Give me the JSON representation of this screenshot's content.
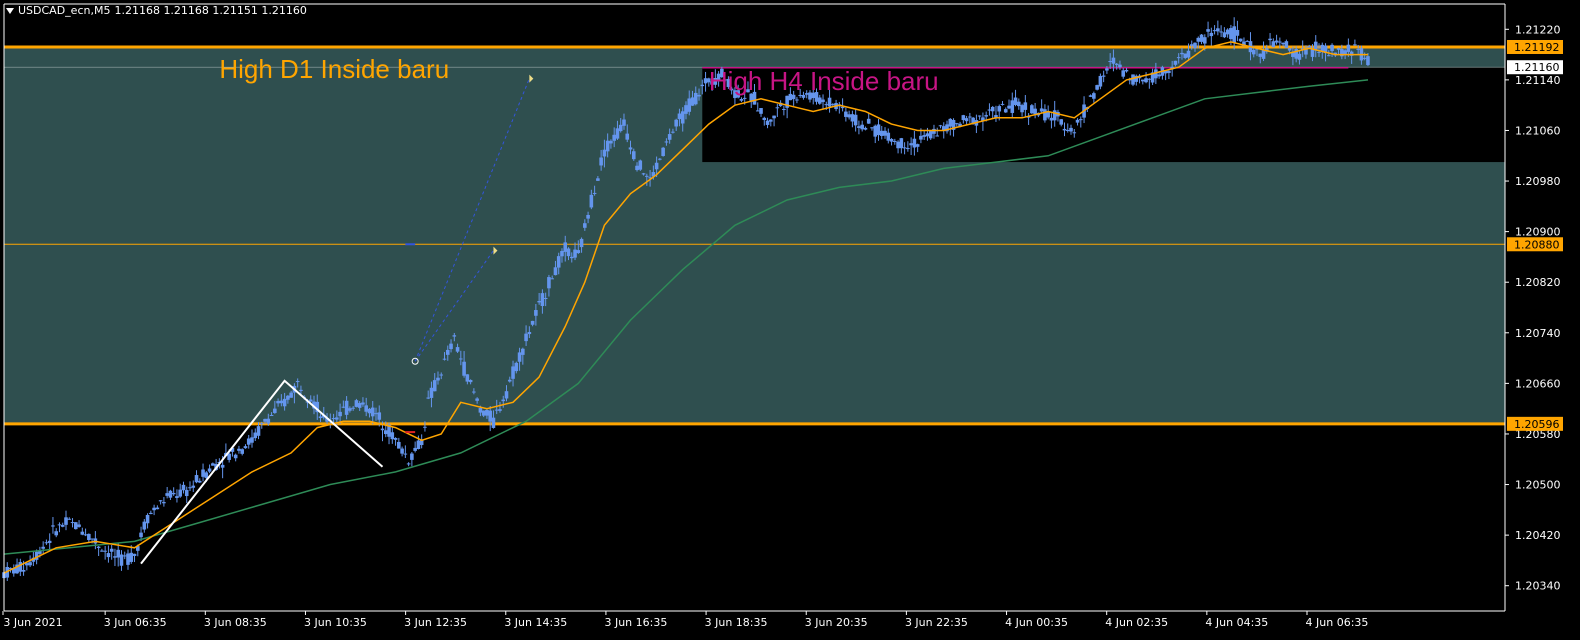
{
  "header": {
    "symbol": "USDCAD_ecn,M5",
    "ohlc": "1.21168 1.21168 1.21151 1.21160"
  },
  "colors": {
    "background": "#000000",
    "candle": "#6495ED",
    "fast_ma": "#FFA500",
    "slow_ma": "#2E8B57",
    "zone_fill": "#2F4F4F",
    "h4_zone": "#000000",
    "level_line": "#FFA500",
    "h4_line": "#C71585",
    "zigzag": "#FFFFFF",
    "axis": "#FFFFFF"
  },
  "chart_data": {
    "type": "line",
    "title": "USDCAD_ecn,M5",
    "ylim": [
      1.203,
      1.2126
    ],
    "y_ticks": [
      "1.21220",
      "1.21140",
      "1.21060",
      "1.20980",
      "1.20900",
      "1.20820",
      "1.20740",
      "1.20660",
      "1.20580",
      "1.20500",
      "1.20420",
      "1.20340"
    ],
    "x_ticks": [
      "3 Jun 2021",
      "3 Jun 06:35",
      "3 Jun 08:35",
      "3 Jun 10:35",
      "3 Jun 12:35",
      "3 Jun 14:35",
      "3 Jun 16:35",
      "3 Jun 18:35",
      "3 Jun 20:35",
      "3 Jun 22:35",
      "4 Jun 00:35",
      "4 Jun 02:35",
      "4 Jun 04:35",
      "4 Jun 06:35"
    ],
    "price_labels": [
      {
        "value": 1.21192,
        "text": "1.21192",
        "style": "orange"
      },
      {
        "value": 1.2116,
        "text": "1.21160",
        "style": "white"
      },
      {
        "value": 1.2088,
        "text": "1.20880",
        "style": "orange"
      },
      {
        "value": 1.20596,
        "text": "1.20596",
        "style": "orange"
      }
    ],
    "levels": [
      {
        "name": "high-d1",
        "value": 1.21192
      },
      {
        "name": "mid",
        "value": 1.2088
      },
      {
        "name": "low-d1",
        "value": 1.20596
      }
    ],
    "annotations": [
      {
        "text": "High D1 Inside baru",
        "color": "#FFA500"
      },
      {
        "text": "High H4 Inside baru",
        "color": "#C71585"
      }
    ],
    "price_series": [
      [
        0,
        1.2036
      ],
      [
        3,
        1.2037
      ],
      [
        5,
        1.2039
      ],
      [
        8,
        1.2043
      ],
      [
        10,
        1.2044
      ],
      [
        12,
        1.2043
      ],
      [
        15,
        1.204
      ],
      [
        18,
        1.2038
      ],
      [
        20,
        1.2039
      ],
      [
        22,
        1.2045
      ],
      [
        25,
        1.2048
      ],
      [
        28,
        1.2049
      ],
      [
        30,
        1.2051
      ],
      [
        32,
        1.2053
      ],
      [
        35,
        1.2055
      ],
      [
        38,
        1.2057
      ],
      [
        40,
        1.206
      ],
      [
        43,
        1.2063
      ],
      [
        45,
        1.2066
      ],
      [
        47,
        1.2064
      ],
      [
        49,
        1.206
      ],
      [
        51,
        1.2061
      ],
      [
        54,
        1.2063
      ],
      [
        56,
        1.2062
      ],
      [
        58,
        1.206
      ],
      [
        60,
        1.2057
      ],
      [
        62,
        1.2054
      ],
      [
        64,
        1.2057
      ],
      [
        65,
        1.2063
      ],
      [
        67,
        1.2068
      ],
      [
        69,
        1.2073
      ],
      [
        71,
        1.2067
      ],
      [
        73,
        1.2062
      ],
      [
        75,
        1.206
      ],
      [
        77,
        1.2065
      ],
      [
        80,
        1.2073
      ],
      [
        82,
        1.2078
      ],
      [
        84,
        1.2083
      ],
      [
        86,
        1.2087
      ],
      [
        88,
        1.2086
      ],
      [
        90,
        1.2095
      ],
      [
        92,
        1.2103
      ],
      [
        95,
        1.2107
      ],
      [
        97,
        1.2101
      ],
      [
        99,
        1.2098
      ],
      [
        102,
        1.2105
      ],
      [
        105,
        1.211
      ],
      [
        108,
        1.2114
      ],
      [
        110,
        1.2115
      ],
      [
        112,
        1.2112
      ],
      [
        115,
        1.2111
      ],
      [
        117,
        1.2107
      ],
      [
        119,
        1.211
      ],
      [
        122,
        1.2112
      ],
      [
        125,
        1.2111
      ],
      [
        128,
        1.211
      ],
      [
        131,
        1.2107
      ],
      [
        134,
        1.2106
      ],
      [
        137,
        1.2104
      ],
      [
        140,
        1.2104
      ],
      [
        143,
        1.2106
      ],
      [
        146,
        1.2107
      ],
      [
        149,
        1.2108
      ],
      [
        152,
        1.2109
      ],
      [
        155,
        1.211
      ],
      [
        158,
        1.2109
      ],
      [
        161,
        1.2108
      ],
      [
        164,
        1.2106
      ],
      [
        167,
        1.2112
      ],
      [
        170,
        1.2117
      ],
      [
        172,
        1.2115
      ],
      [
        174,
        1.2114
      ],
      [
        177,
        1.2115
      ],
      [
        180,
        1.2117
      ],
      [
        183,
        1.212
      ],
      [
        186,
        1.2122
      ],
      [
        189,
        1.2121
      ],
      [
        192,
        1.2118
      ],
      [
        195,
        1.212
      ],
      [
        198,
        1.2118
      ],
      [
        201,
        1.2119
      ],
      [
        204,
        1.2118
      ],
      [
        207,
        1.2119
      ],
      [
        209,
        1.2117
      ]
    ],
    "fast_ma": [
      [
        0,
        1.2036
      ],
      [
        8,
        1.204
      ],
      [
        14,
        1.2041
      ],
      [
        20,
        1.204
      ],
      [
        26,
        1.2044
      ],
      [
        32,
        1.2048
      ],
      [
        38,
        1.2052
      ],
      [
        44,
        1.2055
      ],
      [
        48,
        1.2059
      ],
      [
        52,
        1.206
      ],
      [
        56,
        1.206
      ],
      [
        60,
        1.2059
      ],
      [
        64,
        1.2057
      ],
      [
        67,
        1.2058
      ],
      [
        70,
        1.2063
      ],
      [
        74,
        1.2062
      ],
      [
        78,
        1.2063
      ],
      [
        82,
        1.2067
      ],
      [
        86,
        1.2075
      ],
      [
        89,
        1.2082
      ],
      [
        92,
        1.2091
      ],
      [
        96,
        1.2096
      ],
      [
        100,
        1.2099
      ],
      [
        104,
        1.2103
      ],
      [
        108,
        1.2107
      ],
      [
        112,
        1.211
      ],
      [
        116,
        1.2111
      ],
      [
        120,
        1.211
      ],
      [
        124,
        1.2109
      ],
      [
        128,
        1.211
      ],
      [
        132,
        1.2109
      ],
      [
        136,
        1.2107
      ],
      [
        140,
        1.2106
      ],
      [
        144,
        1.2106
      ],
      [
        148,
        1.2107
      ],
      [
        152,
        1.2108
      ],
      [
        156,
        1.2108
      ],
      [
        160,
        1.2109
      ],
      [
        164,
        1.2108
      ],
      [
        168,
        1.2111
      ],
      [
        172,
        1.2114
      ],
      [
        176,
        1.2115
      ],
      [
        180,
        1.2116
      ],
      [
        184,
        1.2119
      ],
      [
        188,
        1.212
      ],
      [
        192,
        1.2119
      ],
      [
        196,
        1.2118
      ],
      [
        200,
        1.2119
      ],
      [
        204,
        1.2118
      ],
      [
        209,
        1.2118
      ]
    ],
    "slow_ma": [
      [
        0,
        1.2039
      ],
      [
        10,
        1.204
      ],
      [
        20,
        1.2041
      ],
      [
        30,
        1.2044
      ],
      [
        40,
        1.2047
      ],
      [
        50,
        1.205
      ],
      [
        60,
        1.2052
      ],
      [
        70,
        1.2055
      ],
      [
        80,
        1.206
      ],
      [
        88,
        1.2066
      ],
      [
        96,
        1.2076
      ],
      [
        104,
        1.2084
      ],
      [
        112,
        1.2091
      ],
      [
        120,
        1.2095
      ],
      [
        128,
        1.2097
      ],
      [
        136,
        1.2098
      ],
      [
        144,
        1.21
      ],
      [
        152,
        1.2101
      ],
      [
        160,
        1.2102
      ],
      [
        168,
        1.2105
      ],
      [
        176,
        1.2108
      ],
      [
        184,
        1.2111
      ],
      [
        192,
        1.2112
      ],
      [
        200,
        1.2113
      ],
      [
        209,
        1.2114
      ]
    ],
    "zigzag": [
      [
        21,
        1.20375
      ],
      [
        43,
        1.20664
      ],
      [
        58,
        1.20528
      ]
    ]
  }
}
